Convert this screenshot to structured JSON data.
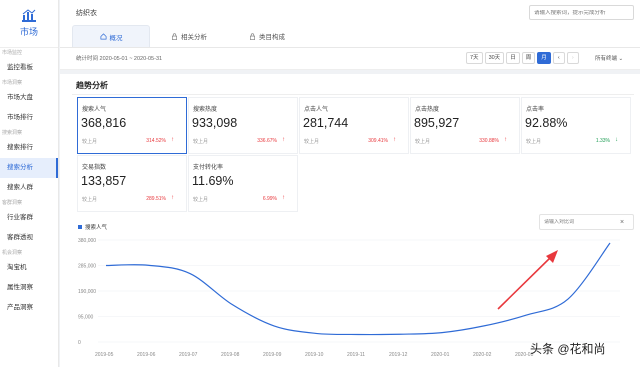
{
  "sidebar": {
    "logo_label": "市场",
    "items": [
      {
        "type": "group",
        "label": "市场监控"
      },
      {
        "type": "item",
        "label": "监控看板"
      },
      {
        "type": "group",
        "label": "市场洞察"
      },
      {
        "type": "item",
        "label": "市场大盘"
      },
      {
        "type": "item",
        "label": "市场排行"
      },
      {
        "type": "group",
        "label": "搜索洞察"
      },
      {
        "type": "item",
        "label": "搜索排行"
      },
      {
        "type": "item",
        "label": "搜索分析",
        "active": true
      },
      {
        "type": "item",
        "label": "搜索人群"
      },
      {
        "type": "group",
        "label": "客群洞察"
      },
      {
        "type": "item",
        "label": "行业客群"
      },
      {
        "type": "item",
        "label": "客群透视"
      },
      {
        "type": "group",
        "label": "机会洞察"
      },
      {
        "type": "item",
        "label": "淘宝机"
      },
      {
        "type": "item",
        "label": "属性洞察"
      },
      {
        "type": "item",
        "label": "产品洞察"
      }
    ]
  },
  "header": {
    "title": "纺织衣",
    "search_placeholder": "请输入搜索词，提示完成分析",
    "tabs": [
      {
        "label": "概况",
        "icon": "home-icon",
        "active": true
      },
      {
        "label": "相关分析",
        "icon": "lock-icon"
      },
      {
        "label": "类目构成",
        "icon": "lock-icon"
      }
    ]
  },
  "datebar": {
    "stat_time": "统计时间 2020-05-01 ~ 2020-05-31",
    "periods": [
      "7天",
      "30天",
      "日",
      "周",
      "月"
    ],
    "active_period": "月",
    "terminal": "所有终端"
  },
  "trend": {
    "title": "趋势分析",
    "compare_label": "较上月",
    "cards": [
      {
        "title": "搜索人气",
        "value": "368,816",
        "pct": "314.52%",
        "dir": "up",
        "active": true
      },
      {
        "title": "搜索热度",
        "value": "933,098",
        "pct": "336.67%",
        "dir": "up"
      },
      {
        "title": "点击人气",
        "value": "281,744",
        "pct": "309.41%",
        "dir": "up"
      },
      {
        "title": "点击热度",
        "value": "895,927",
        "pct": "330.88%",
        "dir": "up"
      },
      {
        "title": "点击率",
        "value": "92.88%",
        "pct": "1.33%",
        "dir": "down"
      },
      {
        "title": "交易指数",
        "value": "133,857",
        "pct": "289.51%",
        "dir": "up"
      },
      {
        "title": "支付转化率",
        "value": "11.69%",
        "pct": "6.99%",
        "dir": "up"
      }
    ]
  },
  "chart": {
    "legend": "搜索人气",
    "search_placeholder": "请输入对比词",
    "close_icon": "close-icon"
  },
  "chart_data": {
    "type": "line",
    "x": [
      "2019-05",
      "2019-06",
      "2019-07",
      "2019-08",
      "2019-09",
      "2019-10",
      "2019-11",
      "2019-12",
      "2020-01",
      "2020-02",
      "2020-03",
      "2020-04",
      "2020-05"
    ],
    "y_ticks": [
      "380,000",
      "285,000",
      "190,000",
      "95,000",
      "0"
    ],
    "ylim": [
      0,
      380000
    ],
    "series": [
      {
        "name": "搜索人气",
        "values": [
          285000,
          286000,
          255000,
          140000,
          60000,
          32000,
          28000,
          29000,
          35000,
          60000,
          100000,
          160000,
          368816
        ]
      }
    ],
    "visible_x_labels": 11,
    "line_color": "#2f6bd6",
    "grid": true
  },
  "watermark": "头条 @花和尚",
  "annotation_color": "#e8383d"
}
